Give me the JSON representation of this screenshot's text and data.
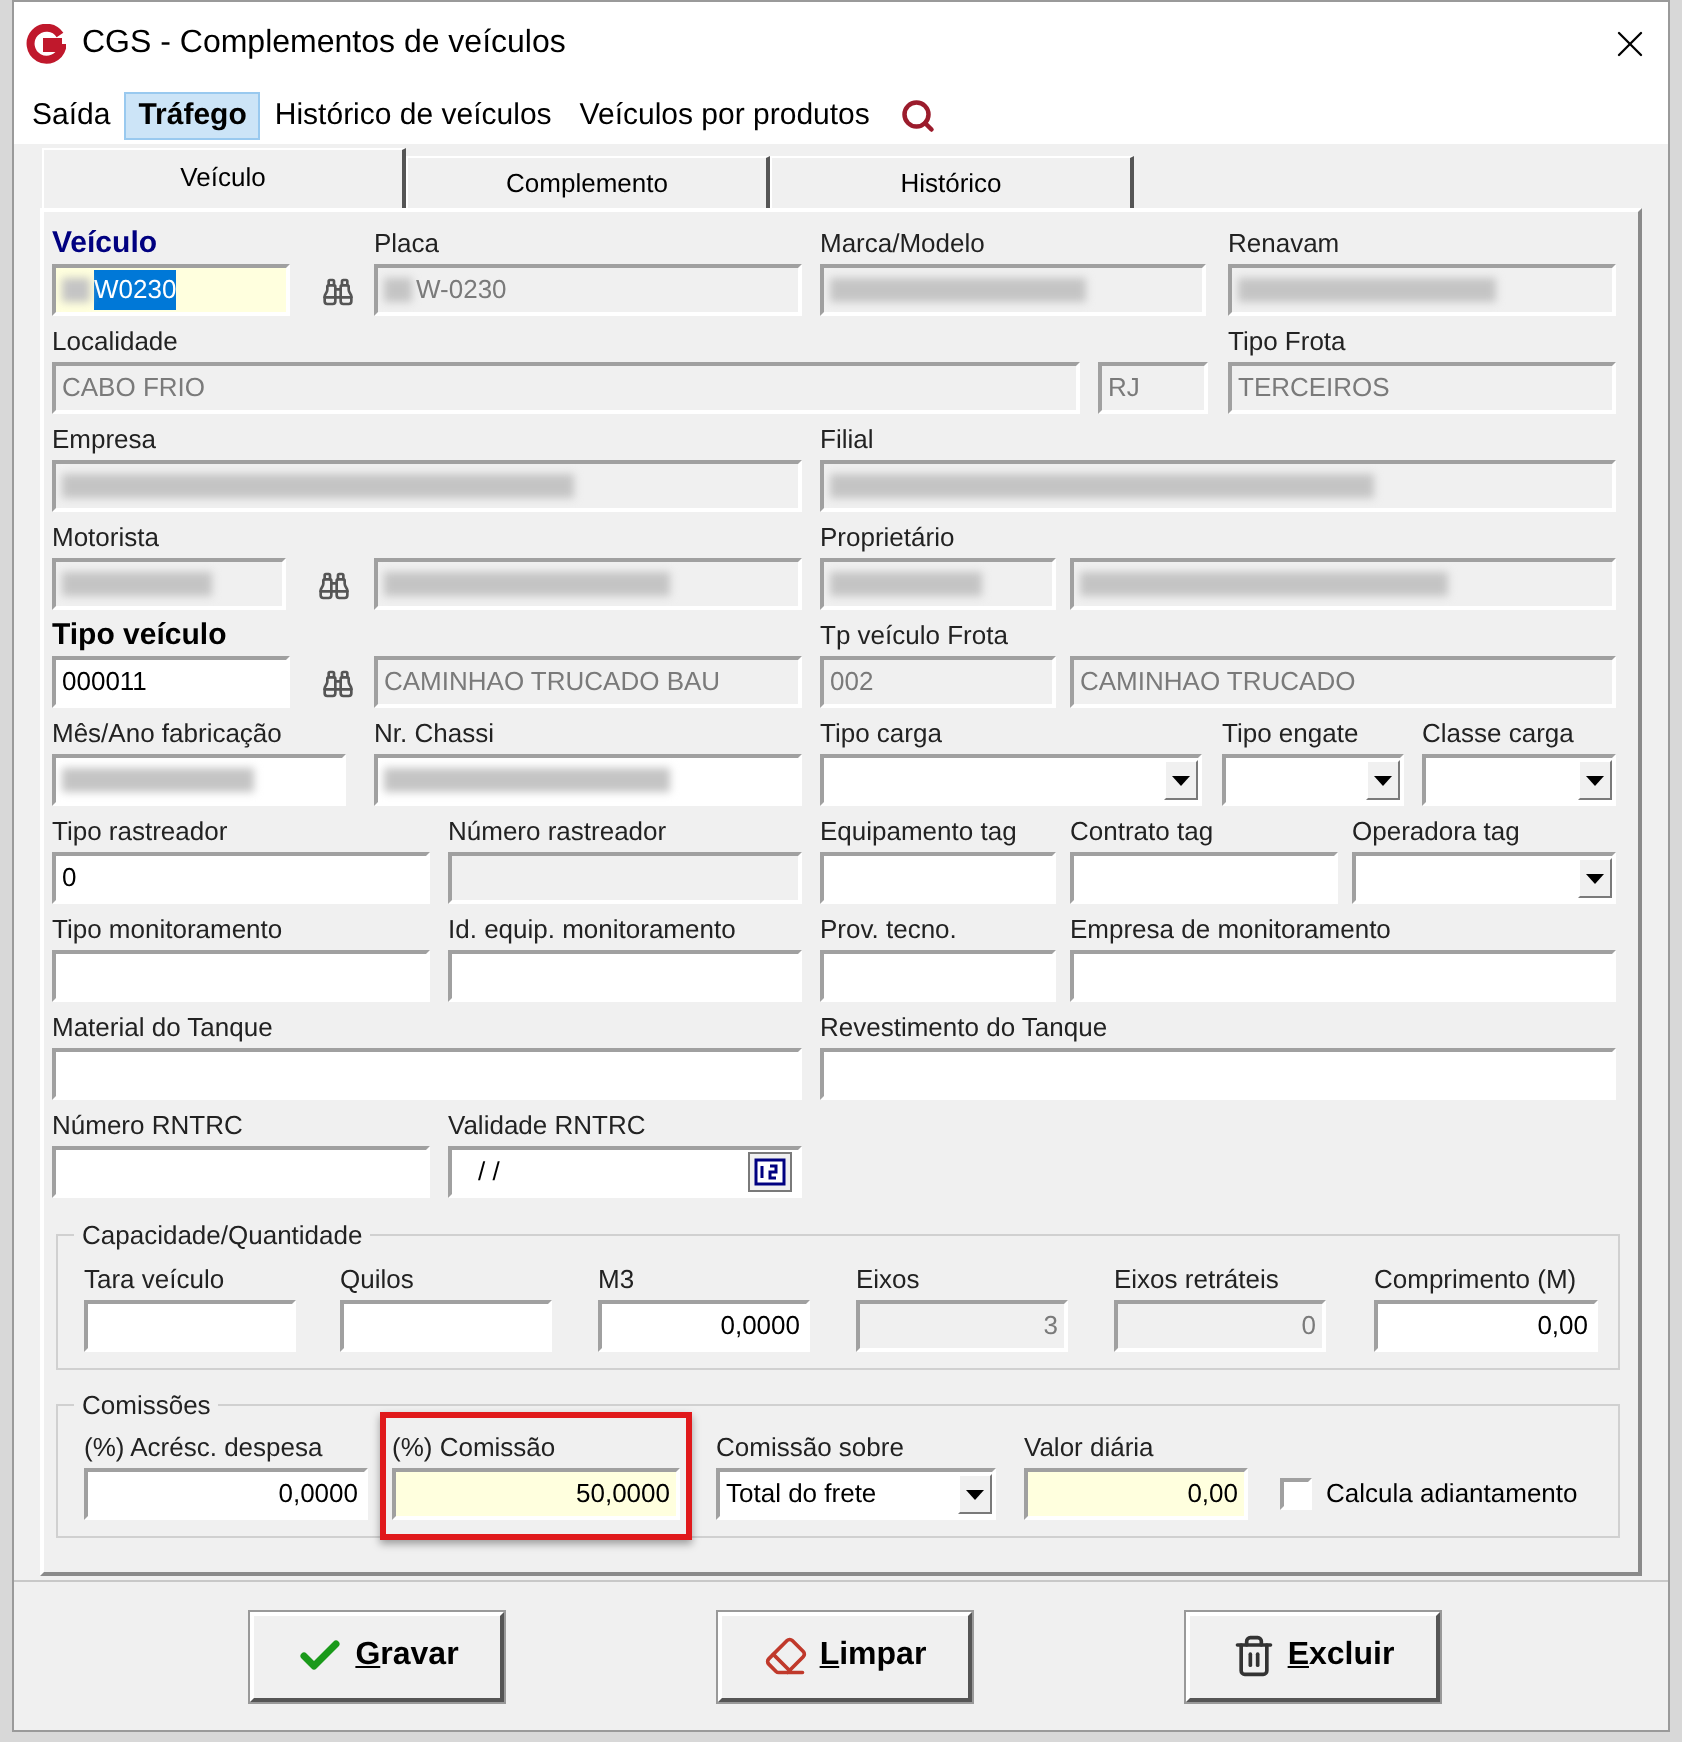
{
  "window": {
    "title": "CGS - Complementos de veículos"
  },
  "menu": [
    {
      "label": "Saída",
      "selected": false
    },
    {
      "label": "Tráfego",
      "selected": true
    },
    {
      "label": "Histórico de veículos",
      "selected": false
    },
    {
      "label": "Veículos por produtos",
      "selected": false
    }
  ],
  "tabs": [
    {
      "label": "Veículo",
      "selected": true
    },
    {
      "label": "Complemento",
      "selected": false
    },
    {
      "label": "Histórico",
      "selected": false
    }
  ],
  "rows": [
    [
      {
        "label": "Veículo",
        "bold_label": true,
        "focused": true,
        "kind": "text",
        "value": "W0230",
        "lookup": true,
        "redacted": true,
        "text_selected": true,
        "highlight": true
      },
      {
        "label": "Placa",
        "kind": "text",
        "value": "W-0230",
        "disabled": true,
        "redacted": true
      },
      {
        "label": "Marca/Modelo",
        "kind": "text",
        "disabled": true,
        "redacted": true
      },
      {
        "label": "Renavam",
        "kind": "text",
        "disabled": true,
        "redacted": true
      }
    ],
    [
      {
        "label": "Localidade",
        "kind": "text",
        "value": "CABO FRIO",
        "disabled": true
      },
      {
        "kind": "text",
        "value": "RJ",
        "disabled": true
      },
      {
        "label": "Tipo Frota",
        "kind": "text",
        "value": "TERCEIROS",
        "disabled": true
      }
    ],
    [
      {
        "label": "Empresa",
        "kind": "text",
        "disabled": true,
        "redacted": true
      },
      {
        "label": "Filial",
        "kind": "text",
        "disabled": true,
        "redacted": true
      }
    ],
    [
      {
        "label": "Motorista",
        "kind": "text",
        "disabled": true,
        "redacted": true,
        "lookup": true
      },
      {
        "kind": "text",
        "disabled": true,
        "redacted": true
      },
      {
        "label": "Proprietário",
        "kind": "text",
        "disabled": true,
        "redacted": true
      },
      {
        "kind": "text",
        "disabled": true,
        "redacted": true
      }
    ],
    [
      {
        "label": "Tipo veículo",
        "bold_label": true,
        "kind": "text",
        "value": "000011",
        "lookup": true
      },
      {
        "kind": "text",
        "value": "CAMINHAO TRUCADO BAU",
        "disabled": true
      },
      {
        "label": "Tp veículo Frota",
        "kind": "text",
        "value": "002",
        "disabled": true
      },
      {
        "kind": "text",
        "value": "CAMINHAO TRUCADO",
        "disabled": true
      }
    ],
    [
      {
        "label": "Mês/Ano fabricação",
        "kind": "text",
        "redacted": true
      },
      {
        "label": "Nr. Chassi",
        "kind": "text",
        "redacted": true
      },
      {
        "label": "Tipo carga",
        "kind": "combo"
      },
      {
        "label": "Tipo engate",
        "kind": "combo"
      },
      {
        "label": "Classe carga",
        "kind": "combo"
      }
    ],
    [
      {
        "label": "Tipo rastreador",
        "kind": "text",
        "value": "0"
      },
      {
        "label": "Número rastreador",
        "kind": "text",
        "disabled": true
      },
      {
        "label": "Equipamento tag",
        "kind": "text"
      },
      {
        "label": "Contrato tag",
        "kind": "text"
      },
      {
        "label": "Operadora tag",
        "kind": "combo"
      }
    ],
    [
      {
        "label": "Tipo monitoramento",
        "kind": "text"
      },
      {
        "label": "Id. equip. monitoramento",
        "kind": "text"
      },
      {
        "label": "Prov. tecno.",
        "kind": "text"
      },
      {
        "label": "Empresa de monitoramento",
        "kind": "text"
      }
    ],
    [
      {
        "label": "Material do Tanque",
        "kind": "text"
      },
      {
        "label": "Revestimento do Tanque",
        "kind": "text"
      }
    ],
    [
      {
        "label": "Número RNTRC",
        "kind": "text"
      },
      {
        "label": "Validade RNTRC",
        "kind": "date",
        "value": "/ /"
      }
    ]
  ],
  "capacity": {
    "title": "Capacidade/Quantidade",
    "fields": [
      {
        "label": "Tara veículo",
        "kind": "number"
      },
      {
        "label": "Quilos",
        "kind": "number"
      },
      {
        "label": "M3",
        "kind": "number",
        "value": "0,0000"
      },
      {
        "label": "Eixos",
        "kind": "number",
        "value": "3",
        "disabled": true
      },
      {
        "label": "Eixos retráteis",
        "kind": "number",
        "value": "0",
        "disabled": true
      },
      {
        "label": "Comprimento (M)",
        "kind": "number",
        "value": "0,00"
      }
    ]
  },
  "commissions": {
    "title": "Comissões",
    "fields": [
      {
        "label": "(%) Acrésc. despesa",
        "kind": "number",
        "value": "0,0000"
      },
      {
        "label": "(%) Comissão",
        "kind": "number",
        "value": "50,0000",
        "highlight": true,
        "callout": true
      },
      {
        "label": "Comissão sobre",
        "kind": "combo",
        "value": "Total do frete"
      },
      {
        "label": "Valor diária",
        "kind": "number",
        "value": "0,00",
        "highlight": true
      },
      {
        "label": "Calcula adiantamento",
        "kind": "checkbox",
        "checked": false
      }
    ]
  },
  "buttons": [
    {
      "label": "Gravar",
      "kind": "save"
    },
    {
      "label": "Limpar",
      "kind": "clear"
    },
    {
      "label": "Excluir",
      "kind": "delete"
    }
  ]
}
